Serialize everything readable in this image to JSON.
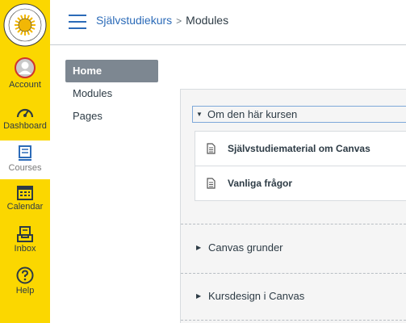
{
  "global_nav": {
    "items": [
      {
        "label": "Account",
        "icon": "account-icon"
      },
      {
        "label": "Dashboard",
        "icon": "dashboard-icon"
      },
      {
        "label": "Courses",
        "icon": "courses-icon",
        "active": true
      },
      {
        "label": "Calendar",
        "icon": "calendar-icon"
      },
      {
        "label": "Inbox",
        "icon": "inbox-icon"
      },
      {
        "label": "Help",
        "icon": "help-icon"
      }
    ],
    "colors": {
      "bar": "#fbd700",
      "accent": "#2c6bb8"
    }
  },
  "breadcrumb": {
    "course": "Självstudiekurs",
    "separator": ">",
    "current": "Modules"
  },
  "course_nav": {
    "items": [
      {
        "label": "Home",
        "active": true
      },
      {
        "label": "Modules"
      },
      {
        "label": "Pages"
      }
    ]
  },
  "modules": [
    {
      "title": "Om den här kursen",
      "expanded": true,
      "items": [
        {
          "title": "Självstudiematerial om Canvas"
        },
        {
          "title": "Vanliga frågor"
        }
      ]
    },
    {
      "title": "Canvas grunder",
      "expanded": false
    },
    {
      "title": "Kursdesign i Canvas",
      "expanded": false
    }
  ]
}
